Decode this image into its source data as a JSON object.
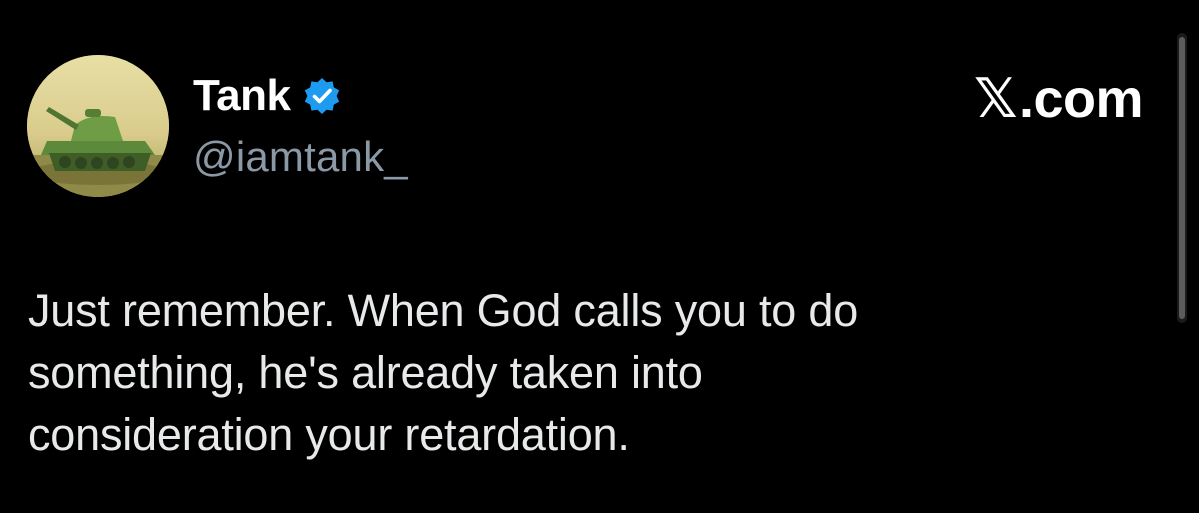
{
  "header": {
    "display_name": "Tank",
    "handle": "@iamtank_",
    "verified": true,
    "brand": {
      "symbol": "𝕏",
      "suffix": ".com"
    }
  },
  "tweet": {
    "text": "Just remember. When God calls you to do\nsomething, he's already taken into\nconsideration your retardation."
  },
  "icons": {
    "avatar": "tank-avatar-icon",
    "verified": "verified-badge-icon"
  },
  "colors": {
    "background": "#000000",
    "text": "#e7e9ea",
    "secondary_text": "#8b98a5",
    "verified_blue": "#1d9bf0"
  }
}
